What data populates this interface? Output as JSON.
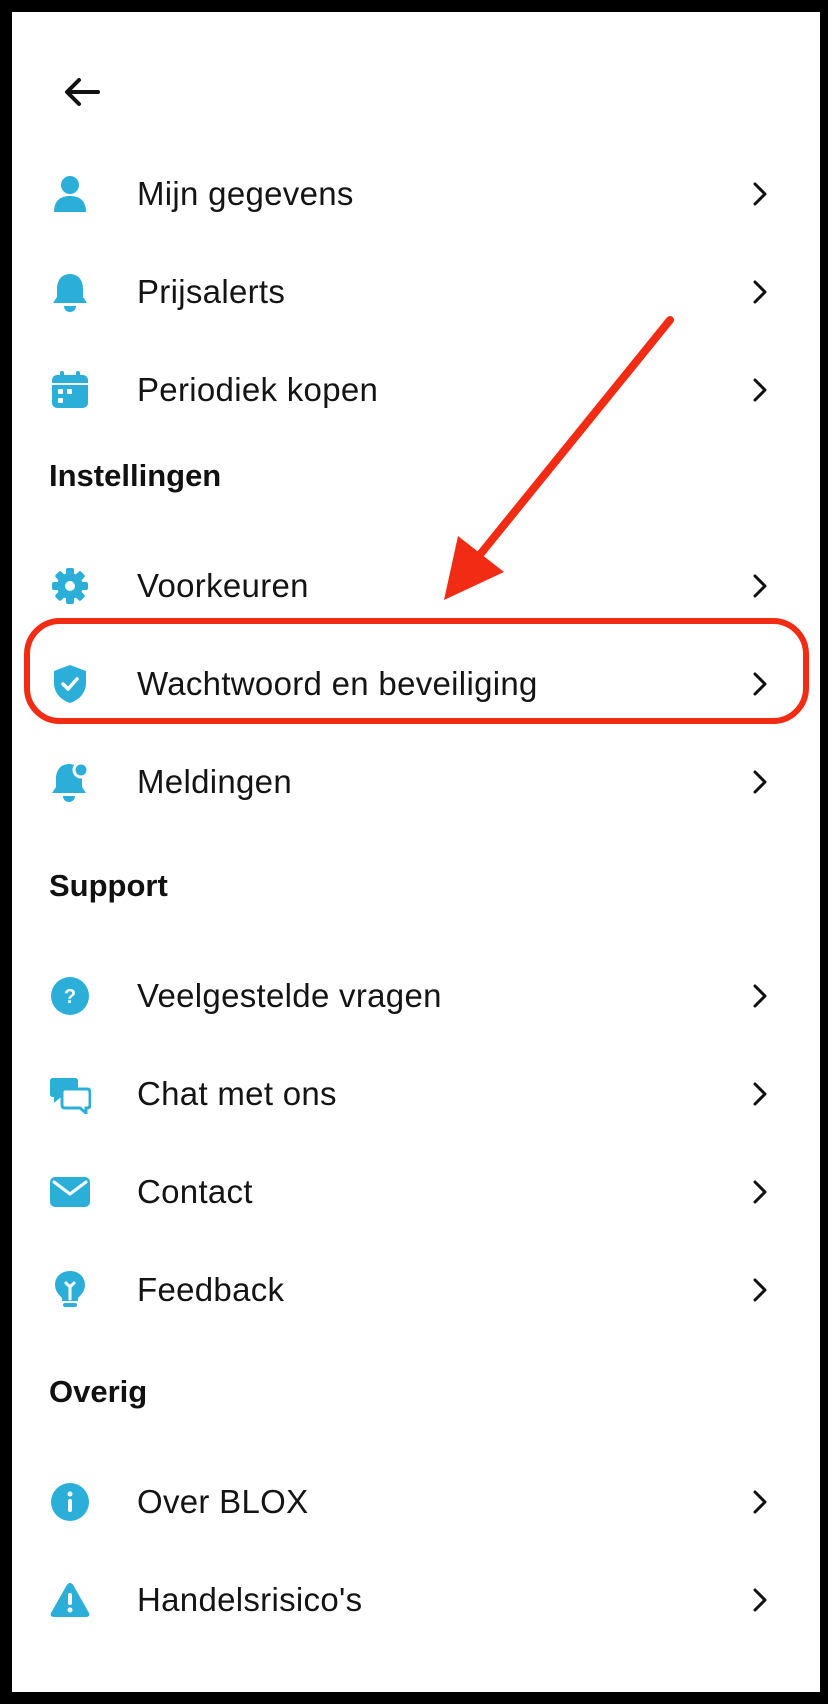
{
  "accent_color": "#2bafd9",
  "annotation_color": "#f22b14",
  "header": {
    "back_icon": "arrow-left-icon"
  },
  "account_items": [
    {
      "label": "Mijn gegevens",
      "icon": "user-icon"
    },
    {
      "label": "Prijsalerts",
      "icon": "bell-icon"
    },
    {
      "label": "Periodiek kopen",
      "icon": "calendar-icon"
    }
  ],
  "settings": {
    "title": "Instellingen",
    "items": [
      {
        "label": "Voorkeuren",
        "icon": "gear-icon"
      },
      {
        "label": "Wachtwoord en beveiliging",
        "icon": "shield-check-icon"
      },
      {
        "label": "Meldingen",
        "icon": "notification-bell-icon"
      }
    ]
  },
  "support": {
    "title": "Support",
    "items": [
      {
        "label": "Veelgestelde vragen",
        "icon": "question-circle-icon"
      },
      {
        "label": "Chat met ons",
        "icon": "chat-bubbles-icon"
      },
      {
        "label": "Contact",
        "icon": "envelope-icon"
      },
      {
        "label": "Feedback",
        "icon": "lightbulb-icon"
      }
    ]
  },
  "other": {
    "title": "Overig",
    "items": [
      {
        "label": "Over BLOX",
        "icon": "info-circle-icon"
      },
      {
        "label": "Handelsrisico's",
        "icon": "warning-triangle-icon"
      }
    ]
  }
}
